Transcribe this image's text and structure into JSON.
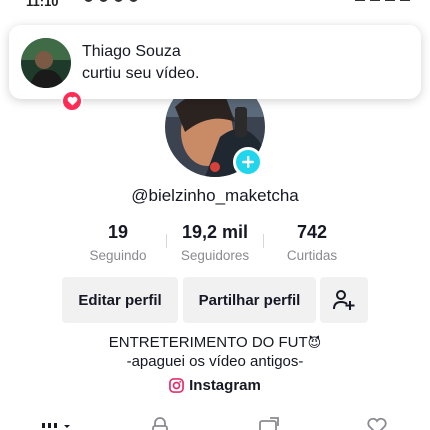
{
  "status_bar": {
    "time": "11:10"
  },
  "notification": {
    "name": "Thiago Souza",
    "text": "curtiu seu vídeo.",
    "icon": "heart-icon"
  },
  "profile": {
    "username": "@bielzinho_maketcha",
    "stats": [
      {
        "value": "19",
        "label": "Seguindo"
      },
      {
        "value": "19,2 mil",
        "label": "Seguidores"
      },
      {
        "value": "742",
        "label": "Curtidas"
      }
    ],
    "buttons": {
      "edit": "Editar perfil",
      "share": "Partilhar perfil",
      "add_friend_icon": "add-friend-icon"
    },
    "bio_line1": "ENTRETERIMENTO DO FUT",
    "bio_emoji": "😈",
    "bio_line2": "-apaguei os vídeo antigos-",
    "link": "Instagram"
  },
  "tabs": [
    "grid-icon",
    "lock-icon",
    "repost-icon",
    "liked-icon"
  ],
  "colors": {
    "accent_cyan": "#20d5ec",
    "accent_red": "#fe2c55",
    "button_bg": "#f1f1f2",
    "text_secondary": "#8a8b91"
  }
}
